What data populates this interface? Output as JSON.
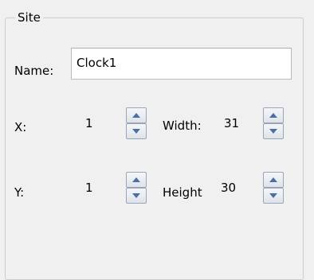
{
  "group": {
    "caption": "Site"
  },
  "name": {
    "label": "Name:",
    "value": "Clock1"
  },
  "x": {
    "label": "X:",
    "value": "1"
  },
  "width": {
    "label": "Width:",
    "value": "31"
  },
  "y": {
    "label": "Y:",
    "value": "1"
  },
  "height": {
    "label": "Height",
    "value": "30"
  },
  "colors": {
    "arrow": "#4a6fa0",
    "border": "#c9ced4",
    "background": "#f0f0f0"
  },
  "icons": {
    "increment": "up-triangle-icon",
    "decrement": "down-triangle-icon"
  }
}
